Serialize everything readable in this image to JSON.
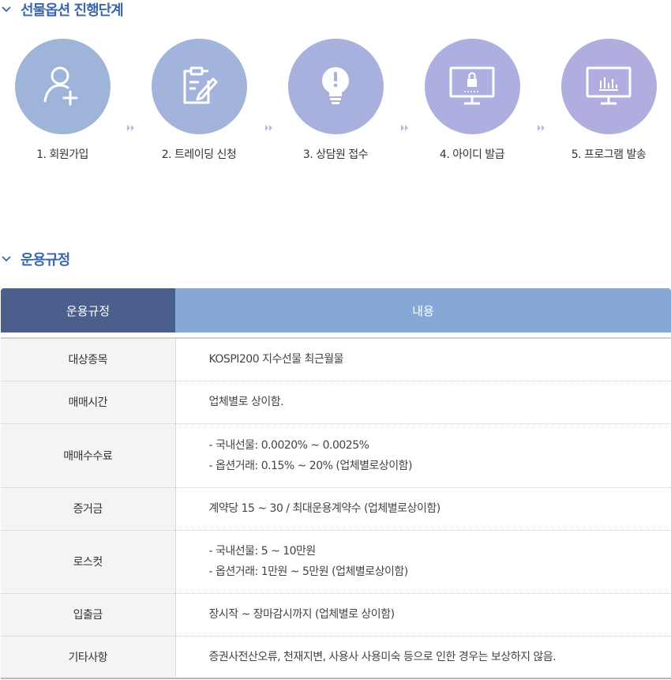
{
  "sections": {
    "process_title": "선물옵션 진행단계",
    "rules_title": "운용규정"
  },
  "steps": [
    {
      "label": "1. 회원가입",
      "icon": "user-add-icon",
      "color": "#9fb4d9"
    },
    {
      "label": "2. 트레이딩 신청",
      "icon": "clipboard-edit-icon",
      "color": "#a2b3dc"
    },
    {
      "label": "3. 상담원 접수",
      "icon": "lightbulb-alert-icon",
      "color": "#a8b1de"
    },
    {
      "label": "4. 아이디 발급",
      "icon": "monitor-lock-icon",
      "color": "#acafdf"
    },
    {
      "label": "5. 프로그램 발송",
      "icon": "monitor-chart-icon",
      "color": "#b0aedf"
    }
  ],
  "table": {
    "headers": [
      "운용규정",
      "내용"
    ],
    "rows": [
      {
        "key": "대상종목",
        "lines": [
          "KOSPI200 지수선물 최근월물"
        ]
      },
      {
        "key": "매매시간",
        "lines": [
          "업체별로 상이함."
        ]
      },
      {
        "key": "매매수수료",
        "lines": [
          "- 국내선물:  0.0020% ~ 0.0025%",
          "- 옵션거래:  0.15% ~ 20%  (업체별로상이함)"
        ]
      },
      {
        "key": "증거금",
        "lines": [
          "계약당 15 ~ 30 / 최대운용계약수 (업체별로상이함)"
        ]
      },
      {
        "key": "로스컷",
        "lines": [
          "- 국내선물: 5 ~  10만원",
          "- 옵션거래: 1만원 ~ 5만원 (업체별로상이함)"
        ]
      },
      {
        "key": "입출금",
        "lines": [
          "장시작 ~ 장마감시까지 (업체별로 상이함)"
        ]
      },
      {
        "key": "기타사항",
        "lines": [
          "증권사전산오류, 천재지변, 사용사 사용미숙 등으로 인한 경우는 보상하지 않음."
        ]
      }
    ]
  },
  "colors": {
    "accent": "#3b67a9",
    "header_dark": "#4a5f8c",
    "header_light": "#85a8d6"
  }
}
